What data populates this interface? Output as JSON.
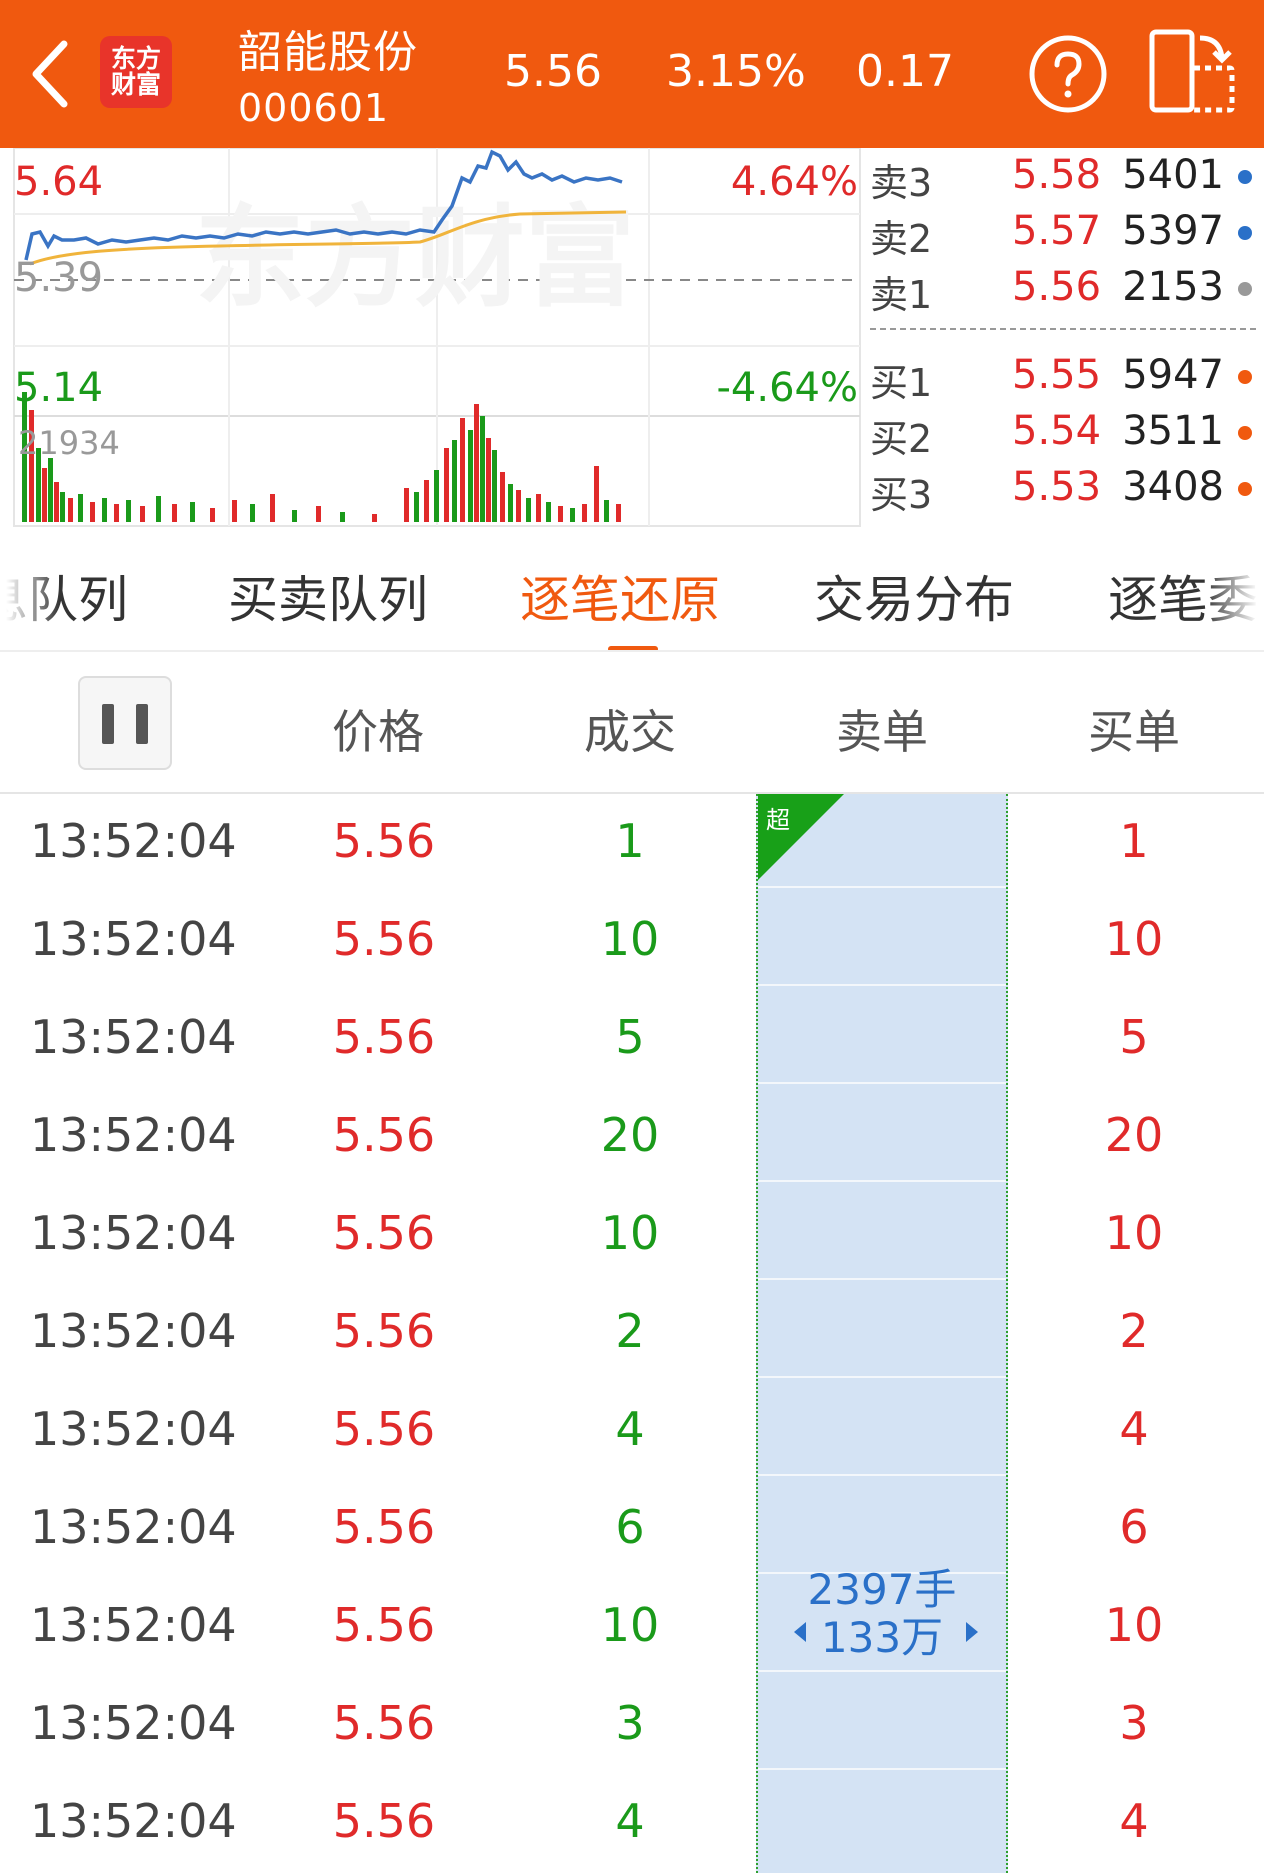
{
  "header": {
    "logo_line1": "东方",
    "logo_line2": "财富",
    "stock_name": "韶能股份",
    "stock_code": "000601",
    "price": "5.56",
    "change_pct": "3.15%",
    "change_amt": "0.17",
    "help_icon": "question-circle-icon",
    "switch_icon": "landscape-switch-icon"
  },
  "chart": {
    "upper_price": "5.64",
    "upper_pct": "4.64%",
    "base_price": "5.39",
    "lower_price": "5.14",
    "lower_pct": "-4.64%",
    "max_volume": "21934",
    "colors": {
      "price_line": "#3a74c4",
      "avg_line": "#f0b43c",
      "vol_up": "#e02a2a",
      "vol_down": "#1a9a1a"
    }
  },
  "orderbook": {
    "asks": [
      {
        "label": "卖3",
        "price": "5.58",
        "volume": "5401",
        "dot_color": "#2a70c8"
      },
      {
        "label": "卖2",
        "price": "5.57",
        "volume": "5397",
        "dot_color": "#2a70c8"
      },
      {
        "label": "卖1",
        "price": "5.56",
        "volume": "2153",
        "dot_color": "#999999"
      }
    ],
    "bids": [
      {
        "label": "买1",
        "price": "5.55",
        "volume": "5947",
        "dot_color": "#f0590f"
      },
      {
        "label": "买2",
        "price": "5.54",
        "volume": "3511",
        "dot_color": "#f0590f"
      },
      {
        "label": "买3",
        "price": "5.53",
        "volume": "3408",
        "dot_color": "#f0590f"
      }
    ]
  },
  "tabs": [
    {
      "label": "息队列"
    },
    {
      "label": "买卖队列"
    },
    {
      "label": "逐笔还原"
    },
    {
      "label": "交易分布"
    },
    {
      "label": "逐笔委"
    }
  ],
  "table": {
    "headers": {
      "price": "价格",
      "volume": "成交",
      "sell": "卖单",
      "buy": "买单"
    },
    "super_tag": "超",
    "sell_summary_lots": "2397手",
    "sell_summary_amount": "133万",
    "rows": [
      {
        "time": "13:52:04",
        "price": "5.56",
        "volume": "1",
        "buy": "1"
      },
      {
        "time": "13:52:04",
        "price": "5.56",
        "volume": "10",
        "buy": "10"
      },
      {
        "time": "13:52:04",
        "price": "5.56",
        "volume": "5",
        "buy": "5"
      },
      {
        "time": "13:52:04",
        "price": "5.56",
        "volume": "20",
        "buy": "20"
      },
      {
        "time": "13:52:04",
        "price": "5.56",
        "volume": "10",
        "buy": "10"
      },
      {
        "time": "13:52:04",
        "price": "5.56",
        "volume": "2",
        "buy": "2"
      },
      {
        "time": "13:52:04",
        "price": "5.56",
        "volume": "4",
        "buy": "4"
      },
      {
        "time": "13:52:04",
        "price": "5.56",
        "volume": "6",
        "buy": "6"
      },
      {
        "time": "13:52:04",
        "price": "5.56",
        "volume": "10",
        "buy": "10"
      },
      {
        "time": "13:52:04",
        "price": "5.56",
        "volume": "3",
        "buy": "3"
      },
      {
        "time": "13:52:04",
        "price": "5.56",
        "volume": "4",
        "buy": "4"
      }
    ]
  }
}
